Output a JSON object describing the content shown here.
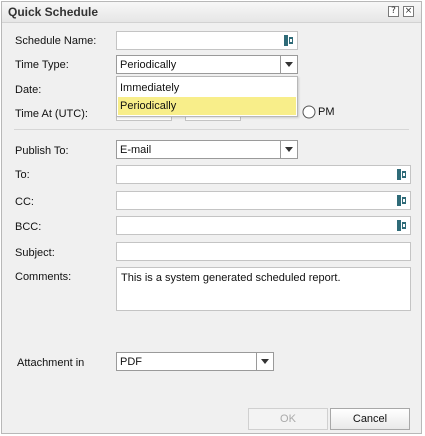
{
  "dialog": {
    "title": "Quick Schedule",
    "help_symbol": "?",
    "close_symbol": "×"
  },
  "form": {
    "schedule_name": {
      "label": "Schedule Name:",
      "value": ""
    },
    "time_type": {
      "label": "Time Type:",
      "selected": "Periodically",
      "options": [
        "Immediately",
        "Periodically"
      ],
      "highlighted": "Periodically"
    },
    "date": {
      "label": "Date:"
    },
    "time_at": {
      "label": "Time At (UTC):",
      "pm_label": "PM"
    },
    "publish_to": {
      "label": "Publish To:",
      "selected": "E-mail"
    },
    "to": {
      "label": "To:",
      "value": ""
    },
    "cc": {
      "label": "CC:",
      "value": ""
    },
    "bcc": {
      "label": "BCC:",
      "value": ""
    },
    "subject": {
      "label": "Subject:",
      "value": ""
    },
    "comments": {
      "label": "Comments:",
      "value": "This is a system generated scheduled report."
    },
    "attachment": {
      "label": "Attachment in",
      "selected": "PDF"
    }
  },
  "buttons": {
    "ok": "OK",
    "cancel": "Cancel"
  },
  "icons": {
    "picker": "address-book-icon",
    "dropdown": "chevron-down-icon"
  },
  "colors": {
    "highlight": "#f8ee8a",
    "picker": "#2f6b78"
  }
}
